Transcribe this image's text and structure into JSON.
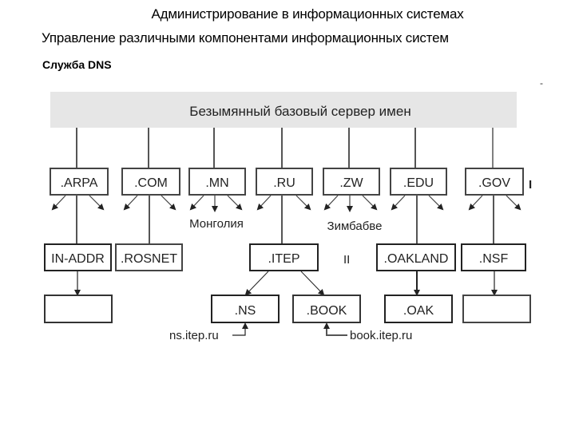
{
  "header": {
    "course_title": "Администрирование в информационных системах",
    "section_title": "Управление различными компонентами информационных систем",
    "topic_title": "Служба DNS",
    "corner_mark": "-"
  },
  "diagram": {
    "root": {
      "label": "Безымянный базовый сервер имен"
    },
    "top_level_domains": [
      {
        "id": "arpa",
        "label": ".ARPA"
      },
      {
        "id": "com",
        "label": ".COM"
      },
      {
        "id": "mn",
        "label": ".MN",
        "annotation": "Монголия"
      },
      {
        "id": "ru",
        "label": ".RU"
      },
      {
        "id": "zw",
        "label": ".ZW",
        "annotation": "Зимбабве"
      },
      {
        "id": "edu",
        "label": ".EDU"
      },
      {
        "id": "gov",
        "label": ".GOV"
      }
    ],
    "second_level_domains": [
      {
        "id": "in-addr",
        "label": "IN-ADDR",
        "parent": "arpa"
      },
      {
        "id": "rosnet",
        "label": ".ROSNET",
        "parent": "com"
      },
      {
        "id": "itep",
        "label": ".ITEP",
        "parent": "ru"
      },
      {
        "id": "oakland",
        "label": ".OAKLAND",
        "parent": "edu"
      },
      {
        "id": "nsf",
        "label": ".NSF",
        "parent": "gov"
      }
    ],
    "third_level_domains": [
      {
        "id": "in-addr-child",
        "label": "",
        "parent": "in-addr"
      },
      {
        "id": "ns",
        "label": ".NS",
        "parent": "itep",
        "host": "ns.itep.ru"
      },
      {
        "id": "book",
        "label": ".BOOK",
        "parent": "itep",
        "host": "book.itep.ru"
      },
      {
        "id": "oak",
        "label": ".OAK",
        "parent": "oakland"
      },
      {
        "id": "nsf-child",
        "label": "",
        "parent": "nsf"
      }
    ],
    "stray_marks": {
      "gov_side": "I",
      "itep_side": "II"
    }
  }
}
